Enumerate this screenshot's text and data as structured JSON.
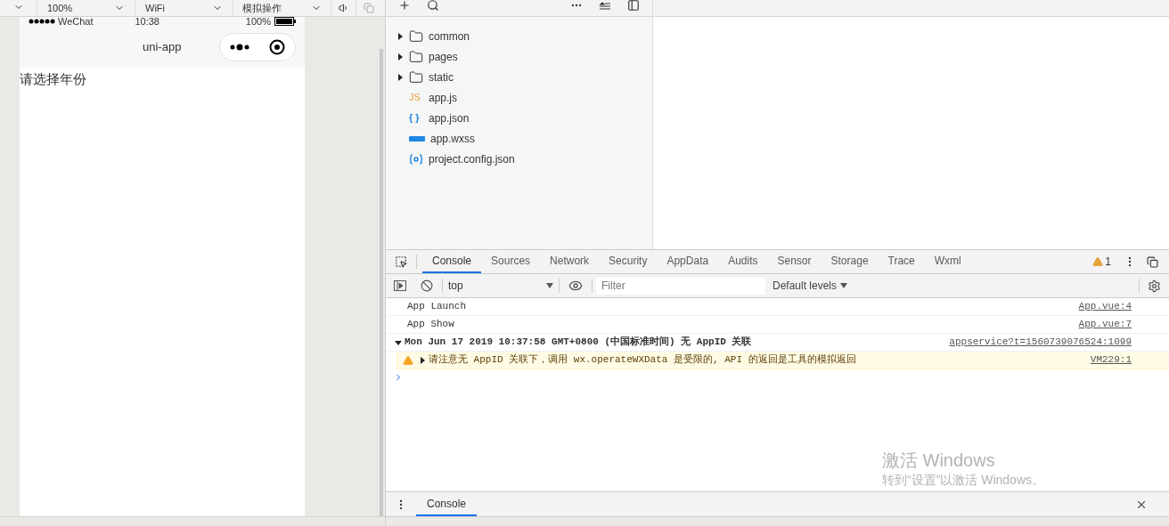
{
  "simulator_toolbar": {
    "zoom": "100%",
    "network": "WiFi",
    "operation": "模拟操作"
  },
  "phone": {
    "status_bar": {
      "carrier": "WeChat",
      "time": "10:38",
      "battery": "100%"
    },
    "nav_title": "uni-app",
    "content": "请选择年份"
  },
  "file_tree": [
    {
      "name": "common",
      "kind": "folder",
      "expanded": false
    },
    {
      "name": "pages",
      "kind": "folder",
      "expanded": false
    },
    {
      "name": "static",
      "kind": "folder",
      "expanded": false
    },
    {
      "name": "app.js",
      "kind": "js",
      "badge": "JS"
    },
    {
      "name": "app.json",
      "kind": "json",
      "badge": "{ }"
    },
    {
      "name": "app.wxss",
      "kind": "wxss"
    },
    {
      "name": "project.config.json",
      "kind": "config"
    }
  ],
  "devtools": {
    "tabs": [
      {
        "label": "Console",
        "selected": true
      },
      {
        "label": "Sources",
        "selected": false
      },
      {
        "label": "Network",
        "selected": false
      },
      {
        "label": "Security",
        "selected": false
      },
      {
        "label": "AppData",
        "selected": false
      },
      {
        "label": "Audits",
        "selected": false
      },
      {
        "label": "Sensor",
        "selected": false
      },
      {
        "label": "Storage",
        "selected": false
      },
      {
        "label": "Trace",
        "selected": false
      },
      {
        "label": "Wxml",
        "selected": false
      }
    ],
    "warning_count": "1",
    "context": "top",
    "filter_placeholder": "Filter",
    "levels": "Default levels",
    "messages": [
      {
        "kind": "log",
        "text": "App Launch",
        "source": "App.vue:4"
      },
      {
        "kind": "log",
        "text": "App Show",
        "source": "App.vue:7"
      },
      {
        "kind": "group",
        "text": "Mon Jun 17 2019 10:37:58 GMT+0800 (中国标准时间) 无 AppID 关联",
        "source": "appservice?t=1560739076524:1099"
      },
      {
        "kind": "warning",
        "text": "请注意无 AppID 关联下，调用 wx.operateWXData 是受限的, API 的返回是工具的模拟返回",
        "source": "VM229:1"
      }
    ],
    "drawer_tab": "Console"
  },
  "activation_notice": {
    "title": "激活 Windows",
    "subtitle": "转到“设置”以激活 Windows。"
  }
}
